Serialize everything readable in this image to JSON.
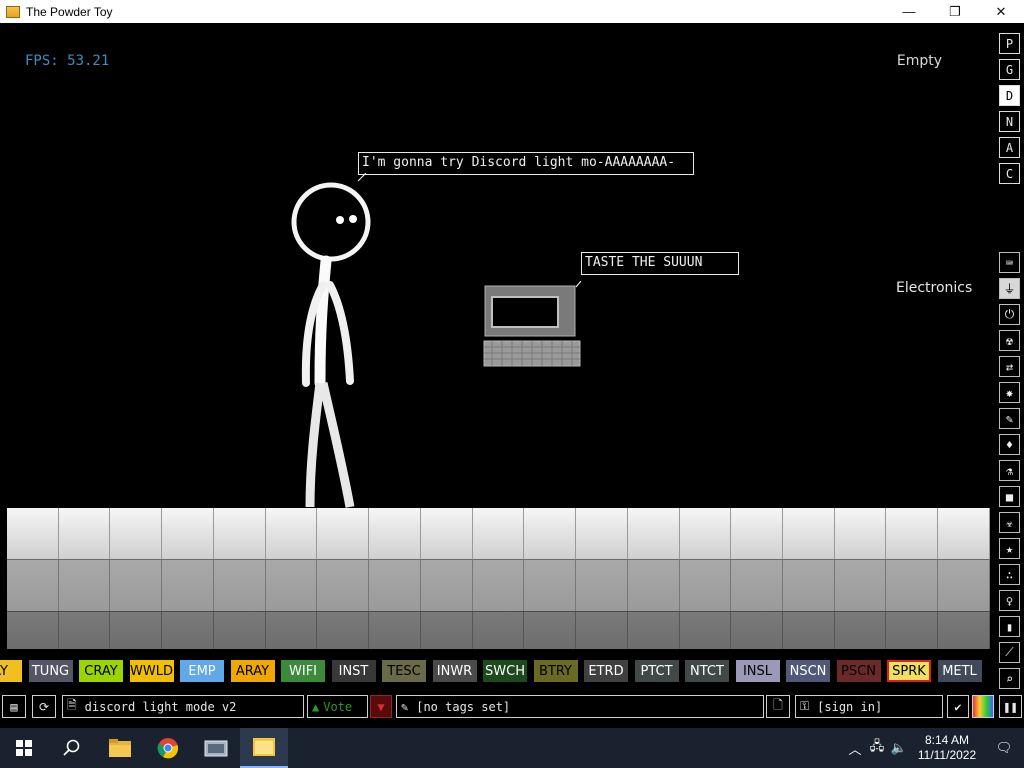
{
  "window": {
    "title": "The Powder Toy",
    "minimize": "—",
    "maximize": "❐",
    "close": "✕"
  },
  "hud": {
    "fps": "FPS: 53.21",
    "status": "Empty",
    "category_tooltip": "Electronics"
  },
  "signs": [
    {
      "text": "I'm gonna try Discord light mo-AAAAAAAA-"
    },
    {
      "text": "TASTE THE SUUUN"
    }
  ],
  "elements": [
    {
      "label": "AY",
      "bg": "#f0c020",
      "fg": "#000000"
    },
    {
      "label": "TUNG",
      "bg": "#555566",
      "fg": "#ffffff"
    },
    {
      "label": "CRAY",
      "bg": "#9bd400",
      "fg": "#000000"
    },
    {
      "label": "WWLD",
      "bg": "#f0c000",
      "fg": "#000000"
    },
    {
      "label": "EMP",
      "bg": "#60a8e8",
      "fg": "#ffffff"
    },
    {
      "label": "ARAY",
      "bg": "#f0a800",
      "fg": "#000000"
    },
    {
      "label": "WIFI",
      "bg": "#3a8a3a",
      "fg": "#ffffff"
    },
    {
      "label": "INST",
      "bg": "#383838",
      "fg": "#ffffff"
    },
    {
      "label": "TESC",
      "bg": "#6a6a48",
      "fg": "#000000"
    },
    {
      "label": "INWR",
      "bg": "#4a4a4a",
      "fg": "#ffffff"
    },
    {
      "label": "SWCH",
      "bg": "#1d4a1d",
      "fg": "#ffffff"
    },
    {
      "label": "BTRY",
      "bg": "#6a6a20",
      "fg": "#000000"
    },
    {
      "label": "ETRD",
      "bg": "#404040",
      "fg": "#ffffff"
    },
    {
      "label": "PTCT",
      "bg": "#404848",
      "fg": "#ffffff"
    },
    {
      "label": "NTCT",
      "bg": "#404848",
      "fg": "#ffffff"
    },
    {
      "label": "INSL",
      "bg": "#9a9ab8",
      "fg": "#000000"
    },
    {
      "label": "NSCN",
      "bg": "#505a78",
      "fg": "#ffffff"
    },
    {
      "label": "PSCN",
      "bg": "#6a2a2a",
      "fg": "#000000"
    },
    {
      "label": "SPRK",
      "bg": "#f0e060",
      "fg": "#000000",
      "selected": true
    },
    {
      "label": "METL",
      "bg": "#404a58",
      "fg": "#ffffff"
    }
  ],
  "sidebar": {
    "modes": [
      "P",
      "G",
      "D",
      "N",
      "A",
      "C"
    ],
    "active_mode": "D",
    "categories": [
      "keyboard-icon",
      "plug-icon",
      "power-icon",
      "radiation-icon",
      "arrows-icon",
      "explosion-icon",
      "pen-icon",
      "drop-icon",
      "flask-icon",
      "square-icon",
      "hazard-icon",
      "star-icon",
      "particles-icon",
      "bulb-icon",
      "bookmark-icon",
      "wand-icon",
      "search-icon"
    ]
  },
  "bottombar": {
    "save_name": "discord light mode v2",
    "vote_label": "Vote",
    "tags": "[no tags set]",
    "signin": "[sign in]"
  },
  "taskbar": {
    "time": "8:14 AM",
    "date": "11/11/2022"
  },
  "colors": {
    "fps": "#3a8ec0",
    "selected_outline": "#e02020",
    "taskbar": "#1a2230"
  }
}
